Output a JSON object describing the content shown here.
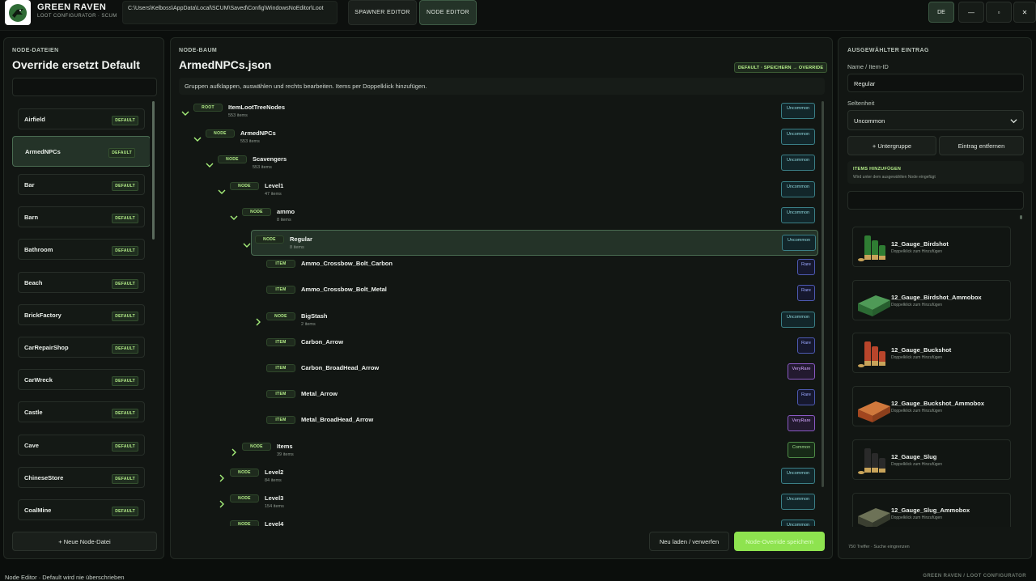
{
  "app": {
    "name": "GREEN RAVEN",
    "subtitle": "LOOT CONFIGURATOR · SCUM",
    "path": "C:\\Users\\Kelboss\\AppData\\Local\\SCUM\\Saved\\Config\\WindowsNoEditor\\Loot",
    "tabs": [
      "SPAWNER EDITOR",
      "NODE EDITOR"
    ],
    "active_tab": "NODE EDITOR",
    "lang": "DE",
    "win_min": "—",
    "win_max": "▫",
    "win_close": "✕"
  },
  "left": {
    "section": "NODE-DATEIEN",
    "title": "Override ersetzt Default",
    "search_value": "",
    "files": [
      {
        "name": "Airfield",
        "badge": "DEFAULT"
      },
      {
        "name": "ArmedNPCs",
        "badge": "DEFAULT",
        "active": true
      },
      {
        "name": "Bar",
        "badge": "DEFAULT"
      },
      {
        "name": "Barn",
        "badge": "DEFAULT"
      },
      {
        "name": "Bathroom",
        "badge": "DEFAULT"
      },
      {
        "name": "Beach",
        "badge": "DEFAULT"
      },
      {
        "name": "BrickFactory",
        "badge": "DEFAULT"
      },
      {
        "name": "CarRepairShop",
        "badge": "DEFAULT"
      },
      {
        "name": "CarWreck",
        "badge": "DEFAULT"
      },
      {
        "name": "Castle",
        "badge": "DEFAULT"
      },
      {
        "name": "Cave",
        "badge": "DEFAULT"
      },
      {
        "name": "ChineseStore",
        "badge": "DEFAULT"
      },
      {
        "name": "CoalMine",
        "badge": "DEFAULT"
      }
    ],
    "new_file": "+ Neue Node-Datei"
  },
  "middle": {
    "section": "NODE-BAUM",
    "title": "ArmedNPCs.json",
    "save_tag": "DEFAULT · SPEICHERN → OVERRIDE",
    "hint": "Gruppen aufklappen, auswählen und rechts bearbeiten. Items per Doppelklick hinzufügen.",
    "tree": [
      {
        "level": 0,
        "chevron": "down",
        "tag": "ROOT",
        "name": "ItemLootTreeNodes",
        "count": "553 items",
        "rarity": "Uncommon"
      },
      {
        "level": 1,
        "chevron": "down",
        "tag": "NODE",
        "name": "ArmedNPCs",
        "count": "553 items",
        "rarity": "Uncommon"
      },
      {
        "level": 2,
        "chevron": "down",
        "tag": "NODE",
        "name": "Scavengers",
        "count": "553 items",
        "rarity": "Uncommon"
      },
      {
        "level": 3,
        "chevron": "down",
        "tag": "NODE",
        "name": "Level1",
        "count": "47 items",
        "rarity": "Uncommon"
      },
      {
        "level": 4,
        "chevron": "down",
        "tag": "NODE",
        "name": "ammo",
        "count": "8 items",
        "rarity": "Uncommon"
      },
      {
        "level": 5,
        "chevron": "down",
        "tag": "NODE",
        "name": "Regular",
        "count": "8 items",
        "rarity": "Uncommon",
        "selected": true
      },
      {
        "level": 6,
        "chevron": "",
        "tag": "ITEM",
        "name": "Ammo_Crossbow_Bolt_Carbon",
        "count": "",
        "rarity": "Rare"
      },
      {
        "level": 6,
        "chevron": "",
        "tag": "ITEM",
        "name": "Ammo_Crossbow_Bolt_Metal",
        "count": "",
        "rarity": "Rare"
      },
      {
        "level": 6,
        "chevron": "right",
        "tag": "NODE",
        "name": "BigStash",
        "count": "2 items",
        "rarity": "Uncommon"
      },
      {
        "level": 6,
        "chevron": "",
        "tag": "ITEM",
        "name": "Carbon_Arrow",
        "count": "",
        "rarity": "Rare"
      },
      {
        "level": 6,
        "chevron": "",
        "tag": "ITEM",
        "name": "Carbon_BroadHead_Arrow",
        "count": "",
        "rarity": "VeryRare"
      },
      {
        "level": 6,
        "chevron": "",
        "tag": "ITEM",
        "name": "Metal_Arrow",
        "count": "",
        "rarity": "Rare"
      },
      {
        "level": 6,
        "chevron": "",
        "tag": "ITEM",
        "name": "Metal_BroadHead_Arrow",
        "count": "",
        "rarity": "VeryRare"
      },
      {
        "level": 4,
        "chevron": "right",
        "tag": "NODE",
        "name": "Items",
        "count": "39 items",
        "rarity": "Common"
      },
      {
        "level": 3,
        "chevron": "right",
        "tag": "NODE",
        "name": "Level2",
        "count": "84 items",
        "rarity": "Uncommon"
      },
      {
        "level": 3,
        "chevron": "right",
        "tag": "NODE",
        "name": "Level3",
        "count": "154 items",
        "rarity": "Uncommon"
      },
      {
        "level": 3,
        "chevron": "right",
        "tag": "NODE",
        "name": "Level4",
        "count": "",
        "rarity": "Uncommon"
      }
    ],
    "reload": "Neu laden / verwerfen",
    "save": "Node-Override speichern"
  },
  "right": {
    "section": "AUSGEWÄHLTER EINTRAG",
    "name_label": "Name / Item-ID",
    "name_value": "Regular",
    "rarity_label": "Seltenheit",
    "rarity_value": "Uncommon",
    "add_sub": "+ Untergruppe",
    "remove": "Eintrag entfernen",
    "add_items_title": "ITEMS HINZUFÜGEN",
    "add_items_sub": "Wird unter dem ausgewählten Node eingefügt",
    "search_value": "",
    "items": [
      {
        "name": "12_Gauge_Birdshot",
        "sub": "Doppelklick zum Hinzufügen",
        "icon": "shotgun-shells-green"
      },
      {
        "name": "12_Gauge_Birdshot_Ammobox",
        "sub": "Doppelklick zum Hinzufügen",
        "icon": "ammo-box-green"
      },
      {
        "name": "12_Gauge_Buckshot",
        "sub": "Doppelklick zum Hinzufügen",
        "icon": "shotgun-shells-red"
      },
      {
        "name": "12_Gauge_Buckshot_Ammobox",
        "sub": "Doppelklick zum Hinzufügen",
        "icon": "ammo-box-orange"
      },
      {
        "name": "12_Gauge_Slug",
        "sub": "Doppelklick zum Hinzufügen",
        "icon": "shotgun-shells-black"
      },
      {
        "name": "12_Gauge_Slug_Ammobox",
        "sub": "Doppelklick zum Hinzufügen",
        "icon": "ammo-box-camo"
      }
    ],
    "footnote": "750 Treffer · Suche eingrenzen"
  },
  "status": {
    "left": "Node Editor · Default wird nie überschrieben",
    "right": "GREEN RAVEN  /  LOOT CONFIGURATOR"
  },
  "colors": {
    "accent": "#8ee34f",
    "uncommon": "#8fd7dd",
    "rare": "#9aa7ff",
    "veryrare": "#d4a8ff",
    "common": "#9edb8e"
  }
}
